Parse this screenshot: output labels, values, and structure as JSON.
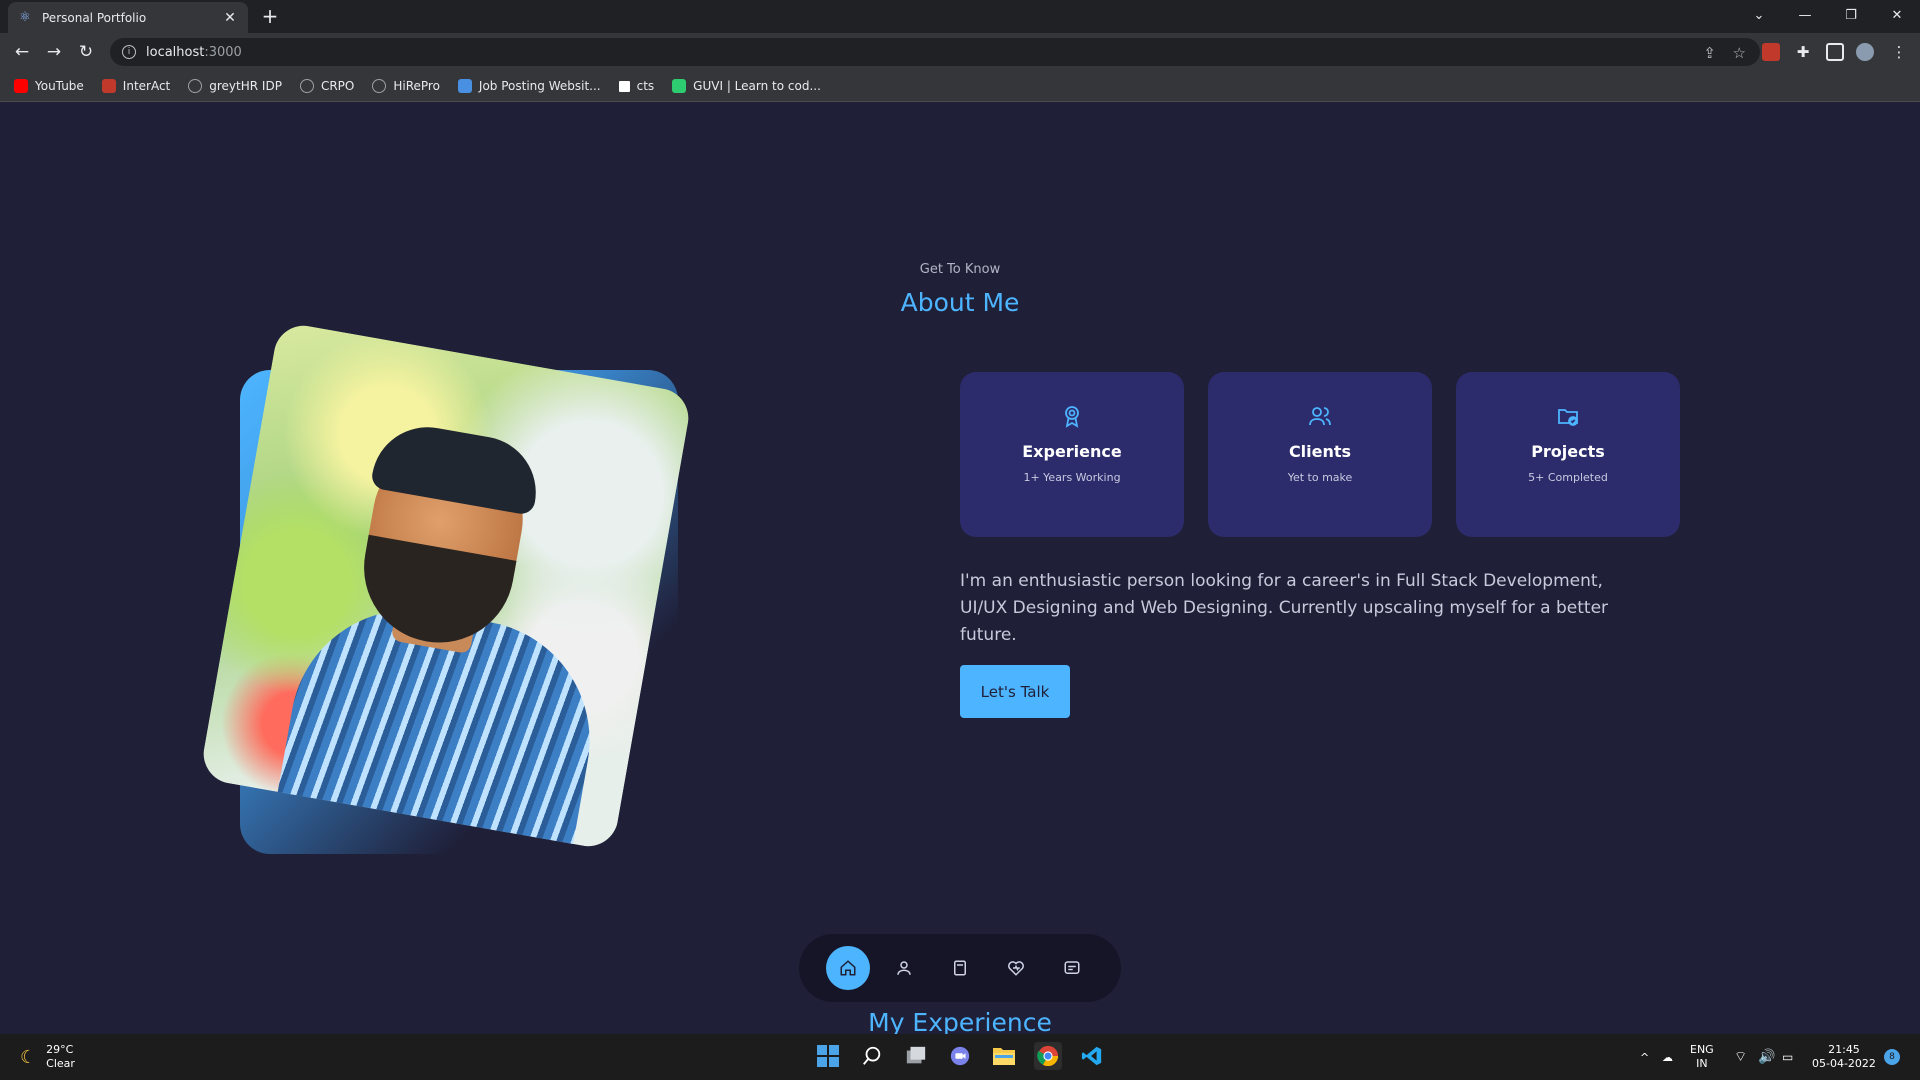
{
  "browser": {
    "tab_title": "Personal Portfolio",
    "url_host": "localhost",
    "url_port": ":3000",
    "bookmarks": [
      {
        "label": "YouTube",
        "icon": "youtube-icon",
        "color": "#ff0000"
      },
      {
        "label": "InterAct",
        "icon": "interact-icon",
        "color": "#c0392b"
      },
      {
        "label": "greytHR IDP",
        "icon": "globe-icon",
        "color": "#9aa0a6"
      },
      {
        "label": "CRPO",
        "icon": "globe-icon",
        "color": "#9aa0a6"
      },
      {
        "label": "HiRePro",
        "icon": "globe-icon",
        "color": "#9aa0a6"
      },
      {
        "label": "Job Posting Websit...",
        "icon": "job-icon",
        "color": "#4a90e2"
      },
      {
        "label": "cts",
        "icon": "cts-icon",
        "color": "#ffffff"
      },
      {
        "label": "GUVI | Learn to cod...",
        "icon": "guvi-icon",
        "color": "#2ecc71"
      }
    ]
  },
  "about": {
    "eyebrow": "Get To Know",
    "title": "About Me",
    "cards": [
      {
        "icon": "award-icon",
        "title": "Experience",
        "subtitle": "1+ Years Working"
      },
      {
        "icon": "users-icon",
        "title": "Clients",
        "subtitle": "Yet to make"
      },
      {
        "icon": "folder-check-icon",
        "title": "Projects",
        "subtitle": "5+ Completed"
      }
    ],
    "description": "I'm an enthusiastic person looking for a career's in Full Stack Development, UI/UX Designing and Web Designing. Currently upscaling myself for a better future.",
    "cta": "Let's Talk"
  },
  "nav": {
    "items": [
      "home-icon",
      "user-icon",
      "book-icon",
      "services-icon",
      "message-icon"
    ],
    "active": 0
  },
  "next_section": {
    "title": "My Experience"
  },
  "taskbar": {
    "temperature": "29°C",
    "condition": "Clear",
    "lang_top": "ENG",
    "lang_bottom": "IN",
    "time": "21:45",
    "date": "05-04-2022",
    "notification_count": "8"
  },
  "colors": {
    "accent": "#4db5ff",
    "bg": "#1f1f38",
    "card": "#2c2c6c"
  }
}
